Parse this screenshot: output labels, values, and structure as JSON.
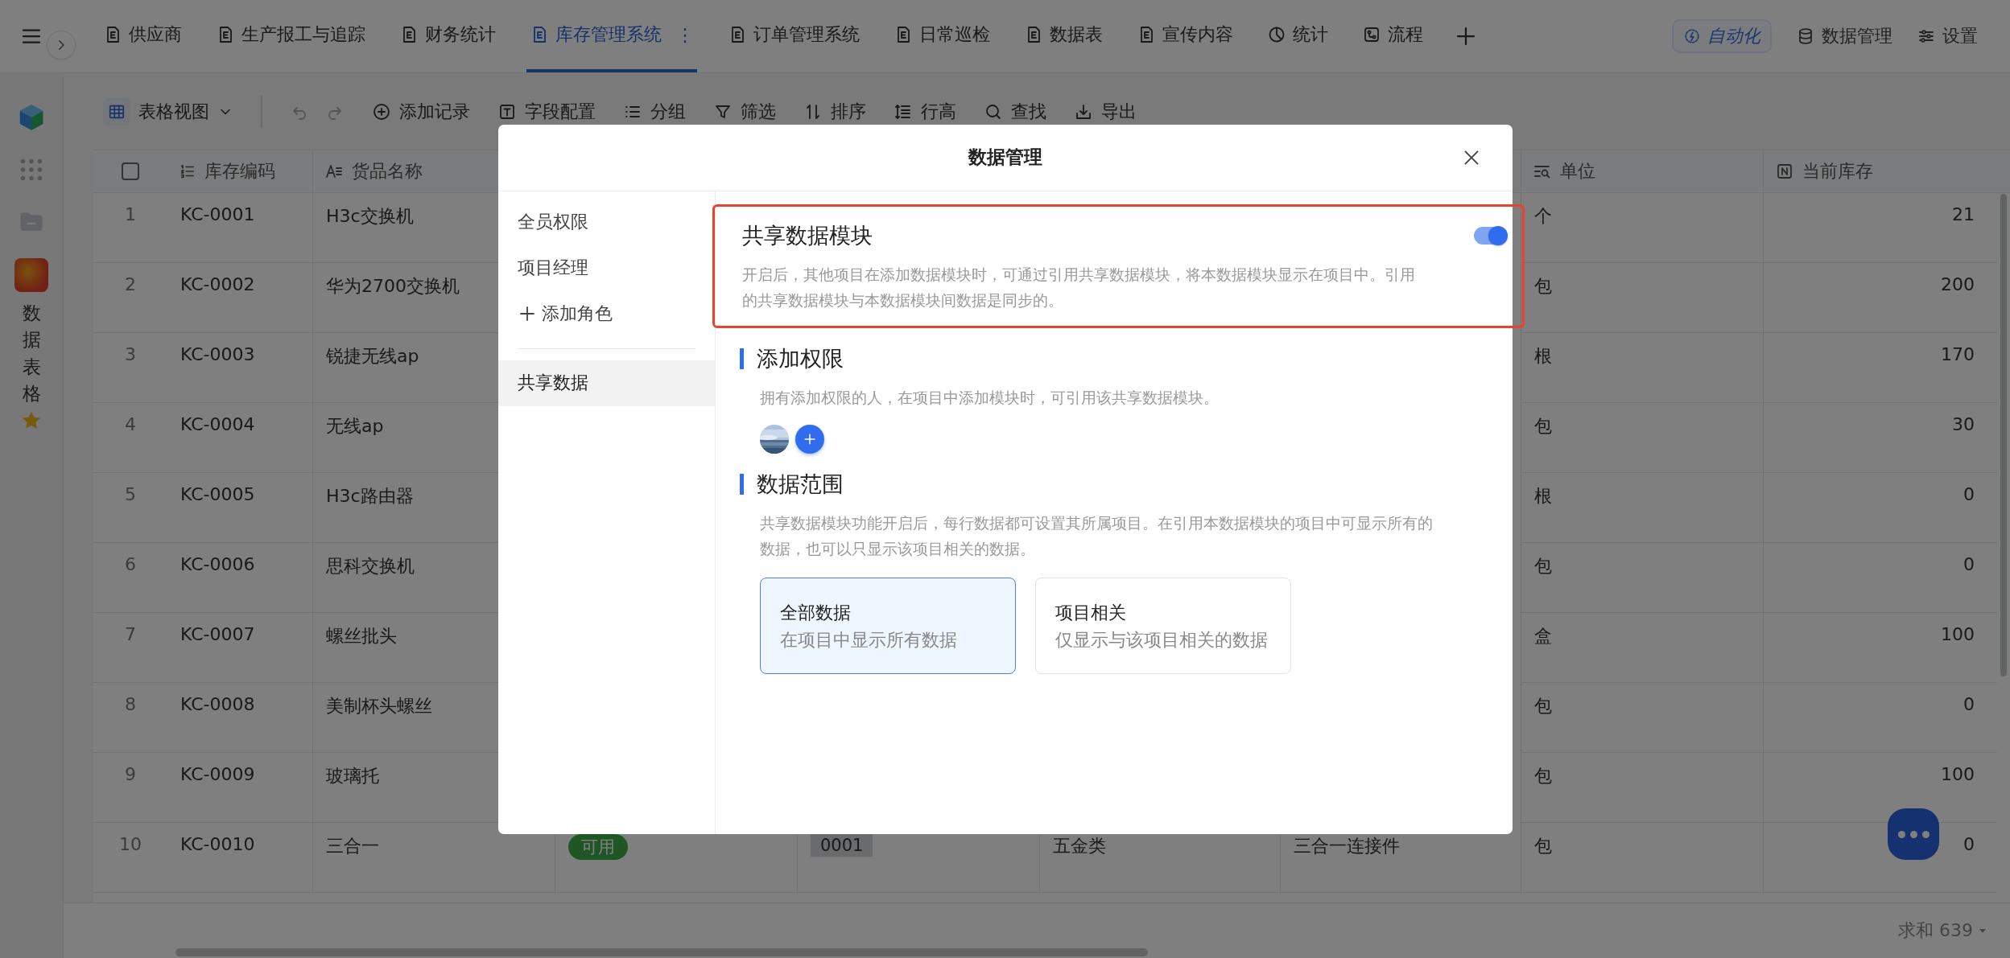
{
  "topbar": {
    "tabs": [
      {
        "label": "供应商",
        "kind": "doc",
        "selected": false
      },
      {
        "label": "生产报工与追踪",
        "kind": "doc",
        "selected": false
      },
      {
        "label": "财务统计",
        "kind": "doc",
        "selected": false
      },
      {
        "label": "库存管理系统",
        "kind": "doc",
        "selected": true,
        "menu": "⋮"
      },
      {
        "label": "订单管理系统",
        "kind": "doc",
        "selected": false
      },
      {
        "label": "日常巡检",
        "kind": "doc",
        "selected": false
      },
      {
        "label": "数据表",
        "kind": "doc",
        "selected": false
      },
      {
        "label": "宣传内容",
        "kind": "doc",
        "selected": false
      },
      {
        "label": "统计",
        "kind": "chart",
        "selected": false
      },
      {
        "label": "流程",
        "kind": "flow",
        "selected": false
      }
    ],
    "actions": [
      {
        "label": "自动化",
        "kind": "automation"
      },
      {
        "label": "数据管理",
        "kind": "database"
      },
      {
        "label": "设置",
        "kind": "settings"
      }
    ]
  },
  "app_rail": {
    "app_name": "数据表格",
    "favorite": true
  },
  "toolbar": {
    "view": "表格视图",
    "tools": [
      {
        "label": "添加记录",
        "kind": "add"
      },
      {
        "label": "字段配置",
        "kind": "field"
      },
      {
        "label": "分组",
        "kind": "group"
      },
      {
        "label": "筛选",
        "kind": "filter"
      },
      {
        "label": "排序",
        "kind": "sort"
      },
      {
        "label": "行高",
        "kind": "height"
      },
      {
        "label": "查找",
        "kind": "search"
      },
      {
        "label": "导出",
        "kind": "export"
      }
    ]
  },
  "table": {
    "select_all": {
      "checked": false
    },
    "columns": [
      {
        "label": "库存编码",
        "kind": "autonumber"
      },
      {
        "label": "货品名称",
        "kind": "text"
      },
      {
        "label": "单位",
        "kind": "lookup"
      },
      {
        "label": "当前库存",
        "kind": "number"
      }
    ],
    "rows": [
      {
        "number": "1",
        "code": "KC-0001",
        "name": "H3c交换机",
        "unit": "个",
        "stock": "21"
      },
      {
        "number": "2",
        "code": "KC-0002",
        "name": "华为2700交换机",
        "unit": "包",
        "stock": "200"
      },
      {
        "number": "3",
        "code": "KC-0003",
        "name": "锐捷无线ap",
        "unit": "根",
        "stock": "170"
      },
      {
        "number": "4",
        "code": "KC-0004",
        "name": "无线ap",
        "unit": "包",
        "stock": "30"
      },
      {
        "number": "5",
        "code": "KC-0005",
        "name": "H3c路由器",
        "unit": "根",
        "stock": "0"
      },
      {
        "number": "6",
        "code": "KC-0006",
        "name": "思科交换机",
        "unit": "包",
        "stock": "0"
      },
      {
        "number": "7",
        "code": "KC-0007",
        "name": "螺丝批头",
        "unit": "盒",
        "stock": "100"
      },
      {
        "number": "8",
        "code": "KC-0008",
        "name": "美制杯头螺丝",
        "unit": "包",
        "stock": "0"
      },
      {
        "number": "9",
        "code": "KC-0009",
        "name": "玻璃托",
        "unit": "包",
        "stock": "100"
      },
      {
        "number": "10",
        "code": "KC-0010",
        "name": "三合一",
        "status": "可用",
        "serial": "0001",
        "category": "五金类",
        "spec": "三合一连接件",
        "unit": "包",
        "stock": "0"
      }
    ]
  },
  "footer": {
    "sum": "求和 639"
  },
  "modal": {
    "title": "数据管理",
    "nav": {
      "roles": [
        {
          "label": "全员权限",
          "selected": false
        },
        {
          "label": "项目经理",
          "selected": false
        }
      ],
      "add_role": "添加角色",
      "pages": [
        {
          "label": "共享数据",
          "selected": true
        }
      ]
    },
    "share": {
      "title": "共享数据模块",
      "on": true,
      "highlighted": true,
      "description": "开启后，其他项目在添加数据模块时，可通过引用共享数据模块，将本数据模块显示在项目中。引用的共享数据模块与本数据模块间数据是同步的。"
    },
    "add_permission": {
      "title": "添加权限",
      "description": "拥有添加权限的人，在项目中添加模块时，可引用该共享数据模块。"
    },
    "data_scope": {
      "title": "数据范围",
      "description": "共享数据模块功能开启后，每行数据都可设置其所属项目。在引用本数据模块的项目中可显示所有的数据，也可以只显示该项目相关的数据。",
      "options": [
        {
          "title": "全部数据",
          "description": "在项目中显示所有数据",
          "selected": true
        },
        {
          "title": "项目相关",
          "description": "仅显示与该项目相关的数据",
          "selected": false
        }
      ]
    }
  }
}
